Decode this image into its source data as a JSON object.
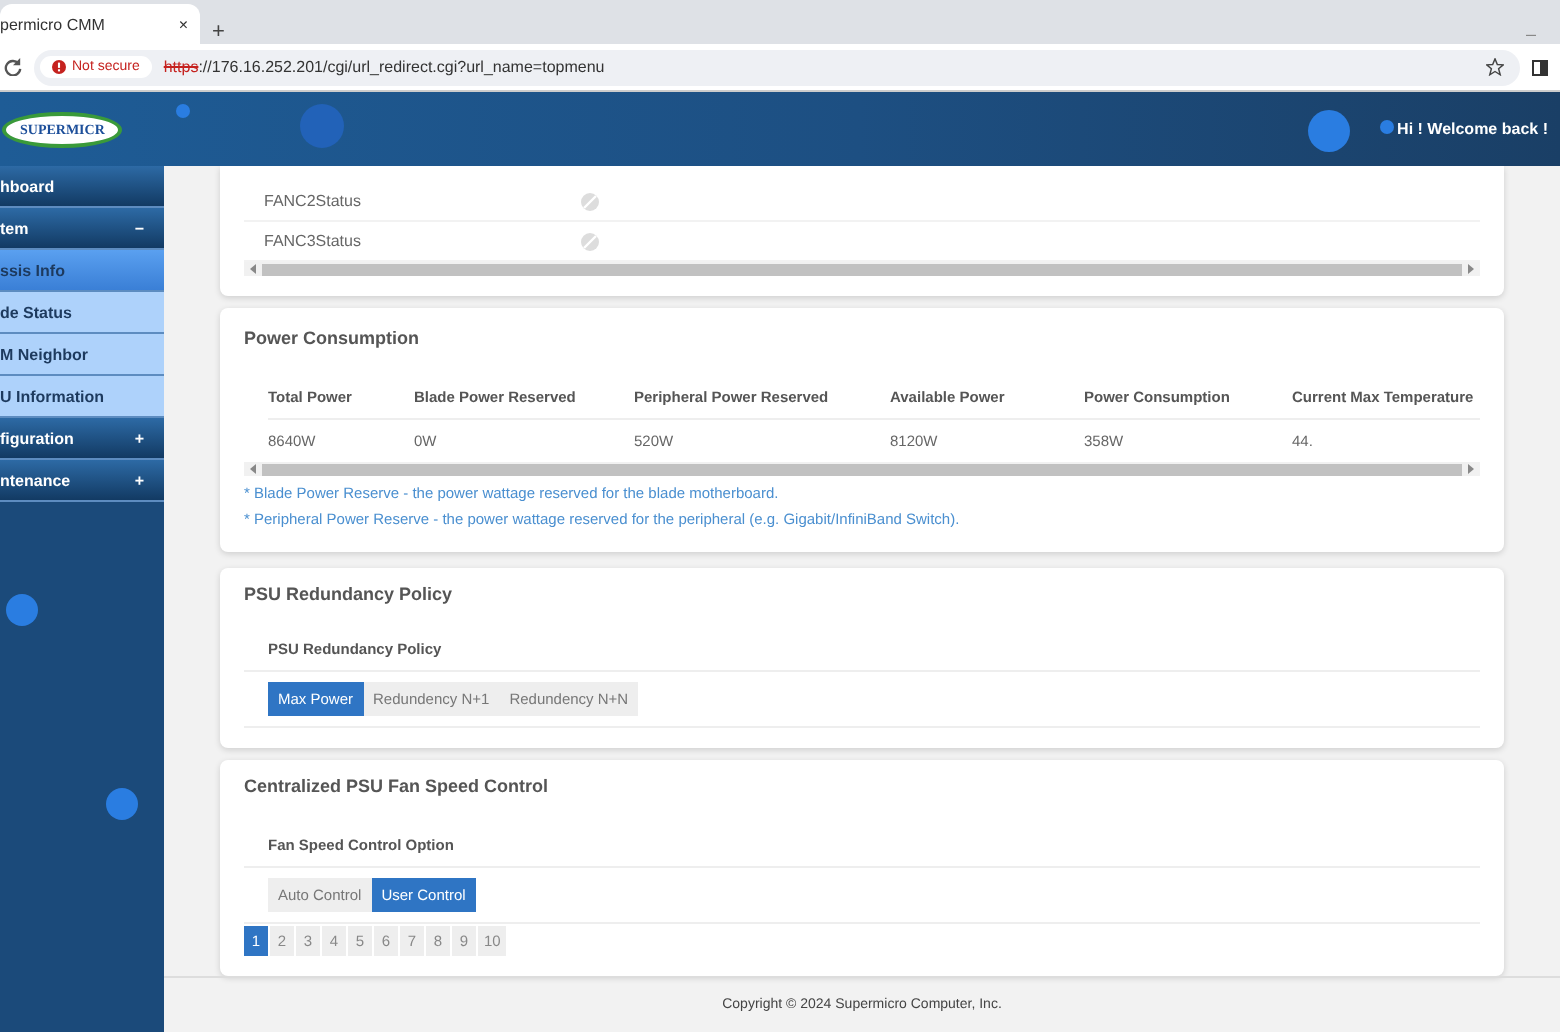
{
  "browser": {
    "tab_title": "permicro CMM",
    "tab_close": "×",
    "new_tab": "+",
    "minimize": "–",
    "security_label": "Not secure",
    "url_scheme": "https",
    "url_rest": "://176.16.252.201/cgi/url_redirect.cgi?url_name=topmenu"
  },
  "header": {
    "logo": "SUPERMICR",
    "greeting": "Hi ! Welcome back !"
  },
  "sidebar": {
    "items": [
      {
        "label": "hboard",
        "kind": "section"
      },
      {
        "label": "tem",
        "kind": "section",
        "toggle": "−"
      },
      {
        "label": "ssis Info",
        "kind": "sub",
        "selected": true
      },
      {
        "label": "de Status",
        "kind": "sub",
        "selected": false
      },
      {
        "label": "M Neighbor",
        "kind": "sub",
        "selected": false
      },
      {
        "label": "U Information",
        "kind": "sub",
        "selected": false
      },
      {
        "label": "figuration",
        "kind": "section",
        "toggle": "+"
      },
      {
        "label": "ntenance",
        "kind": "section",
        "toggle": "+"
      }
    ]
  },
  "fan_status": {
    "rows": [
      {
        "name": "FANC2Status",
        "disabled": true
      },
      {
        "name": "FANC3Status",
        "disabled": true
      }
    ]
  },
  "power": {
    "title": "Power Consumption",
    "columns": [
      "Total Power",
      "Blade Power Reserved",
      "Peripheral Power Reserved",
      "Available Power",
      "Power Consumption",
      "Current Max Temperature"
    ],
    "row": [
      "8640W",
      "0W",
      "520W",
      "8120W",
      "358W",
      "44."
    ],
    "notes": [
      "* Blade Power Reserve - the power wattage reserved for the blade motherboard.",
      "* Peripheral Power Reserve - the power wattage reserved for the peripheral (e.g. Gigabit/InfiniBand Switch)."
    ]
  },
  "psu_policy": {
    "title": "PSU Redundancy Policy",
    "label": "PSU Redundancy Policy",
    "options": [
      {
        "label": "Max Power",
        "selected": true
      },
      {
        "label": "Redundency N+1",
        "selected": false
      },
      {
        "label": "Redundency N+N",
        "selected": false
      }
    ]
  },
  "fan_control": {
    "title": "Centralized PSU Fan Speed Control",
    "label": "Fan Speed Control Option",
    "options": [
      {
        "label": "Auto Control",
        "selected": false
      },
      {
        "label": "User Control",
        "selected": true
      }
    ],
    "pages": [
      {
        "label": "1",
        "selected": true
      },
      {
        "label": "2",
        "selected": false
      },
      {
        "label": "3",
        "selected": false
      },
      {
        "label": "4",
        "selected": false
      },
      {
        "label": "5",
        "selected": false
      },
      {
        "label": "6",
        "selected": false
      },
      {
        "label": "7",
        "selected": false
      },
      {
        "label": "8",
        "selected": false
      },
      {
        "label": "9",
        "selected": false
      },
      {
        "label": "10",
        "selected": false
      }
    ]
  },
  "footer": "Copyright © 2024 Supermicro Computer, Inc."
}
